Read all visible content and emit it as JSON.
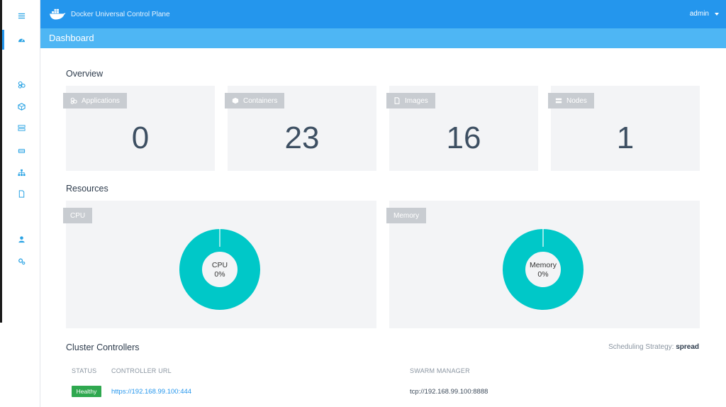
{
  "app": {
    "title": "Docker Universal Control Plane",
    "user": "admin"
  },
  "page": {
    "title": "Dashboard"
  },
  "overview": {
    "title": "Overview",
    "cards": [
      {
        "label": "Applications",
        "value": "0",
        "icon": "applications-icon"
      },
      {
        "label": "Containers",
        "value": "23",
        "icon": "containers-icon"
      },
      {
        "label": "Images",
        "value": "16",
        "icon": "images-icon"
      },
      {
        "label": "Nodes",
        "value": "1",
        "icon": "nodes-icon"
      }
    ]
  },
  "resources": {
    "title": "Resources",
    "cpu": {
      "tag": "CPU",
      "label": "CPU",
      "percent_text": "0%",
      "used_percent": 0
    },
    "memory": {
      "tag": "Memory",
      "label": "Memory",
      "percent_text": "0%",
      "used_percent": 0
    }
  },
  "cluster": {
    "title": "Cluster Controllers",
    "strategy_label": "Scheduling Strategy:",
    "strategy_value": "spread",
    "columns": [
      "STATUS",
      "CONTROLLER URL",
      "SWARM MANAGER"
    ],
    "rows": [
      {
        "status": "Healthy",
        "url": "https://192.168.99.100:444",
        "swarm": "tcp://192.168.99.100:8888"
      }
    ]
  },
  "colors": {
    "accent": "#2496ed",
    "donut": "#00c8c8",
    "healthy": "#2fa84f"
  }
}
